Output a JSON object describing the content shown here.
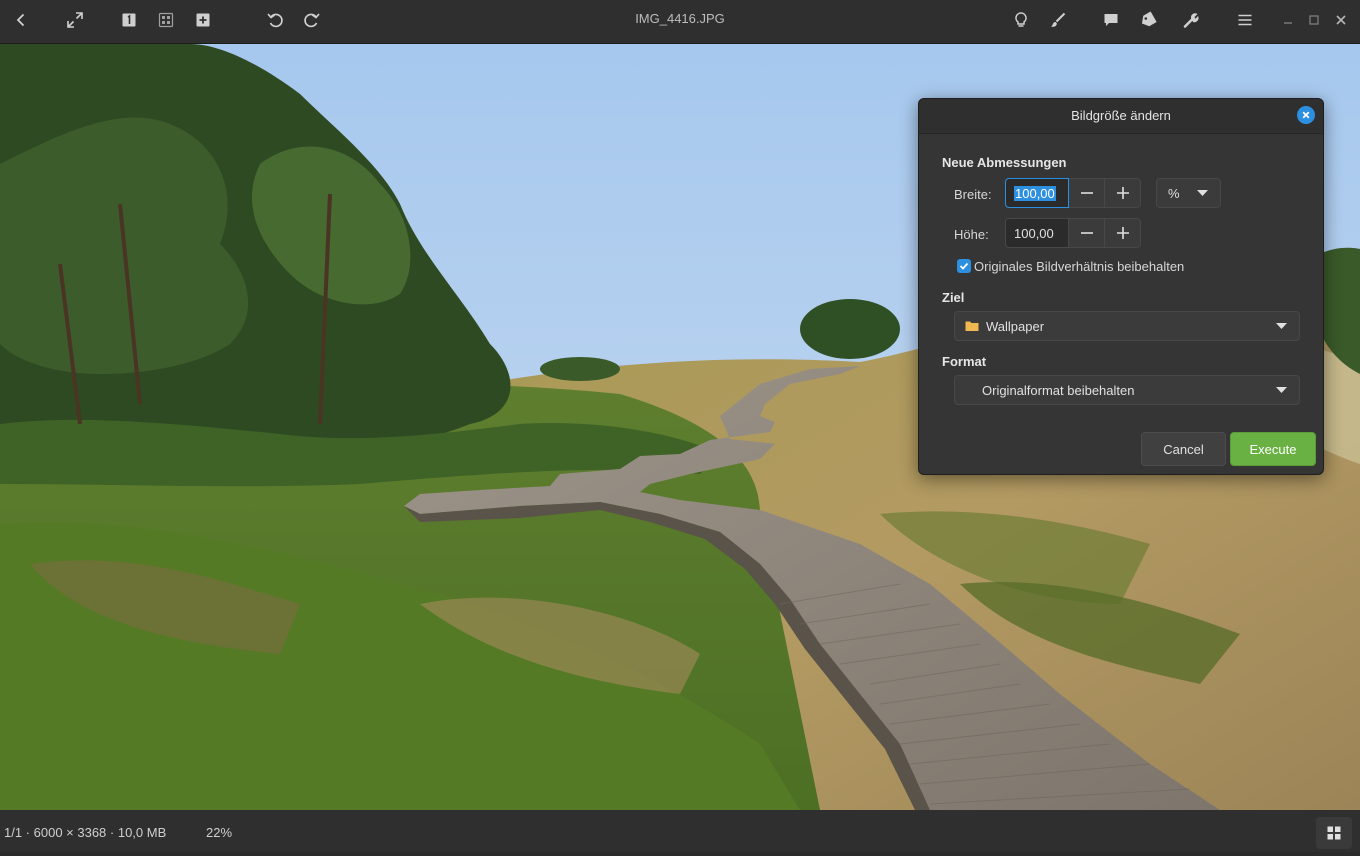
{
  "window": {
    "title": "IMG_4416.JPG"
  },
  "icons": {
    "left": [
      "back-icon",
      "fullscreen-icon",
      "single-view-icon",
      "grid-view-icon",
      "add-icon",
      "undo-icon",
      "redo-icon"
    ],
    "right": [
      "lightbulb-icon",
      "brush-icon",
      "comment-icon",
      "tag-icon",
      "wrench-icon",
      "menu-icon",
      "minimize-icon",
      "maximize-icon",
      "close-icon"
    ]
  },
  "status": {
    "info": "1/1 · 6000 × 3368 · 10,0 MB",
    "zoom": "22%"
  },
  "dialog": {
    "title": "Bildgröße ändern",
    "section_dimensions": "Neue Abmessungen",
    "width_label": "Breite:",
    "width_value": "100,00",
    "height_label": "Höhe:",
    "height_value": "100,00",
    "unit": "%",
    "keep_ratio_label": "Originales Bildverhältnis beibehalten",
    "keep_ratio_checked": true,
    "section_target": "Ziel",
    "target_folder": "Wallpaper",
    "section_format": "Format",
    "format_value": "Originalformat beibehalten",
    "cancel_label": "Cancel",
    "execute_label": "Execute"
  },
  "colors": {
    "accent": "#2d8fe0",
    "execute": "#6ab144",
    "folder": "#f0b850"
  }
}
